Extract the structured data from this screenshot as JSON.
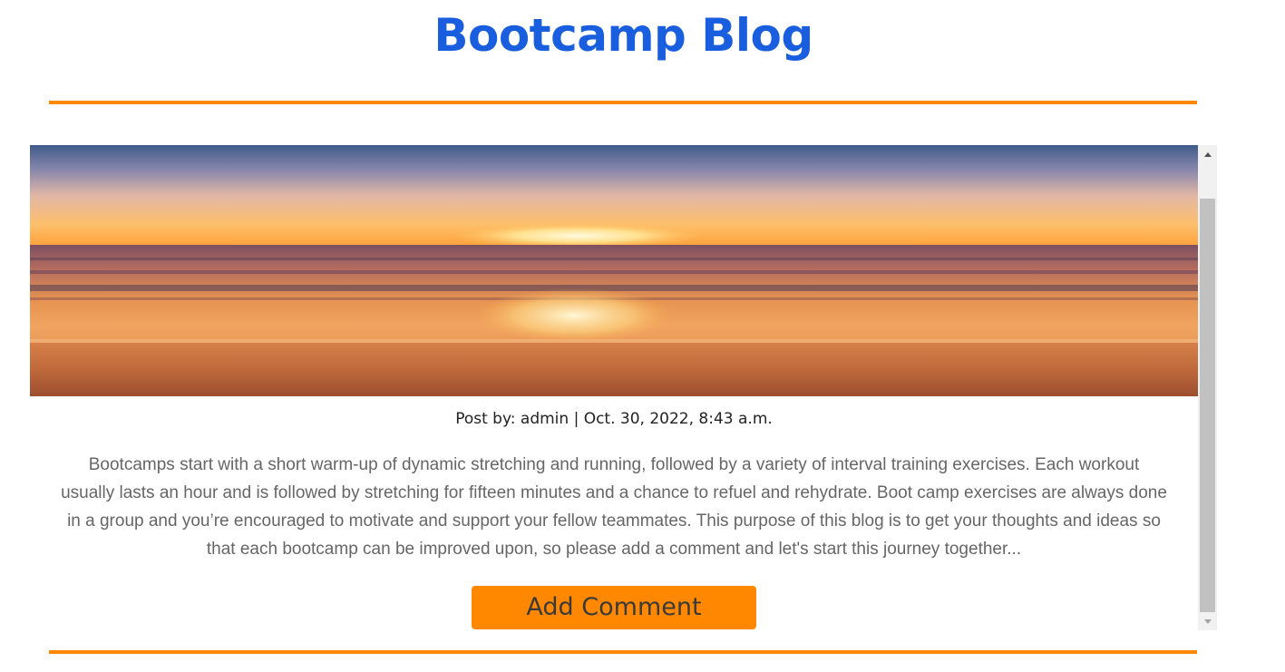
{
  "header": {
    "title": "Bootcamp Blog"
  },
  "post": {
    "image_alt": "Sunset over the ocean",
    "meta": "Post by: admin | Oct. 30, 2022, 8:43 a.m.",
    "body": "Bootcamps start with a short warm-up of dynamic stretching and running, followed by a variety of interval training exercises. Each workout usually lasts an hour and is followed by stretching for fifteen minutes and a chance to refuel and rehydrate. Boot camp exercises are always done in a group and you’re encouraged to motivate and support your fellow teammates. This purpose of this blog is to get your thoughts and ideas so that each bootcamp can be improved upon, so please add a comment and let's start this journey together...",
    "add_comment_label": "Add Comment"
  },
  "colors": {
    "title": "#1a5ee0",
    "accent": "#ff8800",
    "body_text": "#666666"
  }
}
